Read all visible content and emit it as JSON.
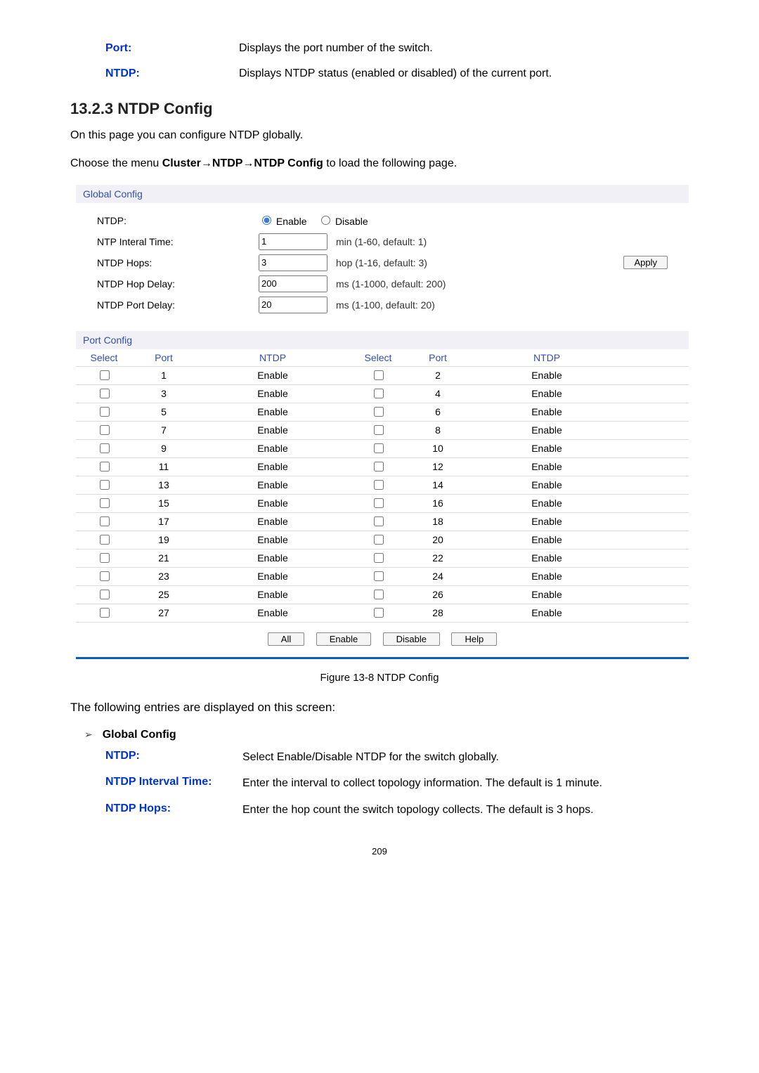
{
  "top_defs": [
    {
      "term": "Port:",
      "desc": "Displays the port number of the switch."
    },
    {
      "term": "NTDP:",
      "desc": "Displays NTDP status (enabled or disabled) of the current port."
    }
  ],
  "section_number_title": "13.2.3  NTDP Config",
  "intro_line": "On this page you can configure NTDP globally.",
  "menu_line_prefix": "Choose the menu ",
  "menu_line_bold": "Cluster→NTDP→NTDP Config",
  "menu_line_suffix": " to load the following page.",
  "global_config": {
    "header": "Global Config",
    "rows": {
      "ntdp_label": "NTDP:",
      "enable_label": "Enable",
      "disable_label": "Disable",
      "interval_label": "NTP Interal Time:",
      "interval_value": "1",
      "interval_hint": "min (1-60, default: 1)",
      "hops_label": "NTDP Hops:",
      "hops_value": "3",
      "hops_hint": "hop (1-16, default: 3)",
      "hop_delay_label": "NTDP Hop Delay:",
      "hop_delay_value": "200",
      "hop_delay_hint": "ms (1-1000, default: 200)",
      "port_delay_label": "NTDP Port Delay:",
      "port_delay_value": "20",
      "port_delay_hint": "ms (1-100, default: 20)",
      "apply_label": "Apply"
    }
  },
  "port_config": {
    "header": "Port Config",
    "col_select": "Select",
    "col_port": "Port",
    "col_ntdp": "NTDP",
    "rows": [
      {
        "l_port": "1",
        "l_ntdp": "Enable",
        "r_port": "2",
        "r_ntdp": "Enable"
      },
      {
        "l_port": "3",
        "l_ntdp": "Enable",
        "r_port": "4",
        "r_ntdp": "Enable"
      },
      {
        "l_port": "5",
        "l_ntdp": "Enable",
        "r_port": "6",
        "r_ntdp": "Enable"
      },
      {
        "l_port": "7",
        "l_ntdp": "Enable",
        "r_port": "8",
        "r_ntdp": "Enable"
      },
      {
        "l_port": "9",
        "l_ntdp": "Enable",
        "r_port": "10",
        "r_ntdp": "Enable"
      },
      {
        "l_port": "11",
        "l_ntdp": "Enable",
        "r_port": "12",
        "r_ntdp": "Enable"
      },
      {
        "l_port": "13",
        "l_ntdp": "Enable",
        "r_port": "14",
        "r_ntdp": "Enable"
      },
      {
        "l_port": "15",
        "l_ntdp": "Enable",
        "r_port": "16",
        "r_ntdp": "Enable"
      },
      {
        "l_port": "17",
        "l_ntdp": "Enable",
        "r_port": "18",
        "r_ntdp": "Enable"
      },
      {
        "l_port": "19",
        "l_ntdp": "Enable",
        "r_port": "20",
        "r_ntdp": "Enable"
      },
      {
        "l_port": "21",
        "l_ntdp": "Enable",
        "r_port": "22",
        "r_ntdp": "Enable"
      },
      {
        "l_port": "23",
        "l_ntdp": "Enable",
        "r_port": "24",
        "r_ntdp": "Enable"
      },
      {
        "l_port": "25",
        "l_ntdp": "Enable",
        "r_port": "26",
        "r_ntdp": "Enable"
      },
      {
        "l_port": "27",
        "l_ntdp": "Enable",
        "r_port": "28",
        "r_ntdp": "Enable"
      }
    ],
    "actions": {
      "all": "All",
      "enable": "Enable",
      "disable": "Disable",
      "help": "Help"
    }
  },
  "figure_caption": "Figure 13-8 NTDP Config",
  "follow_text": "The following entries are displayed on this screen:",
  "sub_section_title": "Global Config",
  "entries": [
    {
      "term": "NTDP:",
      "desc": "Select Enable/Disable NTDP for the switch globally."
    },
    {
      "term": "NTDP Interval Time:",
      "desc": "Enter the interval to collect topology information. The default is 1 minute."
    },
    {
      "term": "NTDP Hops:",
      "desc": "Enter the hop count the switch topology collects. The default is 3 hops."
    }
  ],
  "page_number": "209"
}
